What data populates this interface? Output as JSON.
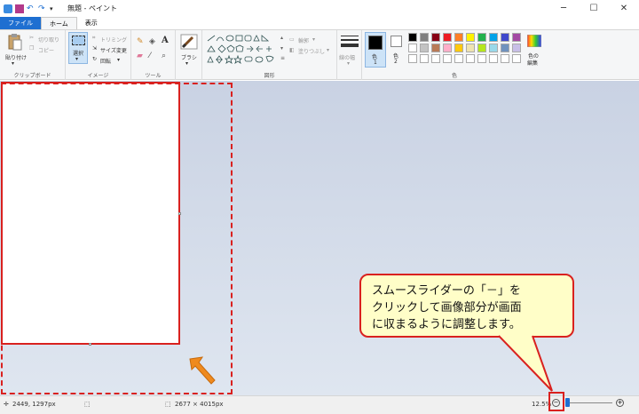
{
  "window": {
    "title": "無題 - ペイント",
    "minimize": "─",
    "maximize": "☐",
    "close": "✕"
  },
  "tabs": [
    "ファイル",
    "ホーム",
    "表示"
  ],
  "ribbon": {
    "clipboard": {
      "paste": "貼り付け",
      "cut": "切り取り",
      "copy": "コピー",
      "label": "クリップボード"
    },
    "image": {
      "select": "選択",
      "crop": "トリミング",
      "resize": "サイズ変更",
      "rotate": "回転",
      "label": "イメージ"
    },
    "tools": {
      "label": "ツール"
    },
    "brush": {
      "label": "ブラシ"
    },
    "shapes": {
      "outline": "輪郭",
      "fill": "塗りつぶし",
      "label": "図形"
    },
    "size": {
      "label": "線の幅"
    },
    "colors": {
      "color1": "色",
      "color1_num": "1",
      "color2": "色",
      "color2_num": "2",
      "edit": "色の",
      "edit2": "編集",
      "label": "色"
    },
    "palette_row1": [
      "#000000",
      "#7f7f7f",
      "#880015",
      "#ed1c24",
      "#ff7f27",
      "#fff200",
      "#22b14c",
      "#00a2e8",
      "#3f48cc",
      "#a349a4"
    ],
    "palette_row2": [
      "#ffffff",
      "#c3c3c3",
      "#b97a57",
      "#ffaec9",
      "#ffc90e",
      "#efe4b0",
      "#b5e61d",
      "#99d9ea",
      "#7092be",
      "#c8bfe7"
    ]
  },
  "callout": {
    "line1": "スムースライダーの「－」を",
    "line2": "クリックして画像部分が画面",
    "line3": "に収まるように調整します。"
  },
  "status": {
    "cursor": "2449, 1297px",
    "size": "2677 × 4015px",
    "zoom": "12.5%"
  },
  "accent": "#d9211f"
}
